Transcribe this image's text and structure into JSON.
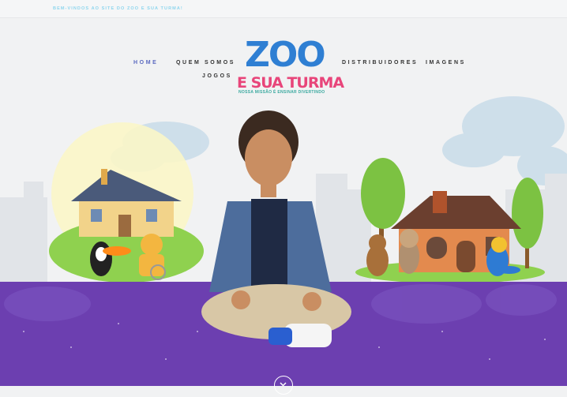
{
  "topbar": {
    "welcome": "BEM-VINDOS AO SITE DO ZOO E SUA TURMA!"
  },
  "nav": {
    "home": "HOME",
    "quem_somos": "QUEM SOMOS",
    "jogos": "JOGOS",
    "distribuidores": "DISTRIBUIDORES",
    "imagens": "IMAGENS"
  },
  "logo": {
    "title": "ZOO",
    "subtitle": "E SUA TURMA",
    "tagline": "NOSSA MISSÃO É ENSINAR DIVERTINDO"
  },
  "colors": {
    "accent": "#5c6bc0",
    "purple_band": "#6c3fb0",
    "topbar_text": "#8fd6ee",
    "logo_pink": "#e8457a",
    "logo_blue": "#2f7fd3"
  },
  "icons": {
    "scroll_down": "chevron-down-icon"
  }
}
